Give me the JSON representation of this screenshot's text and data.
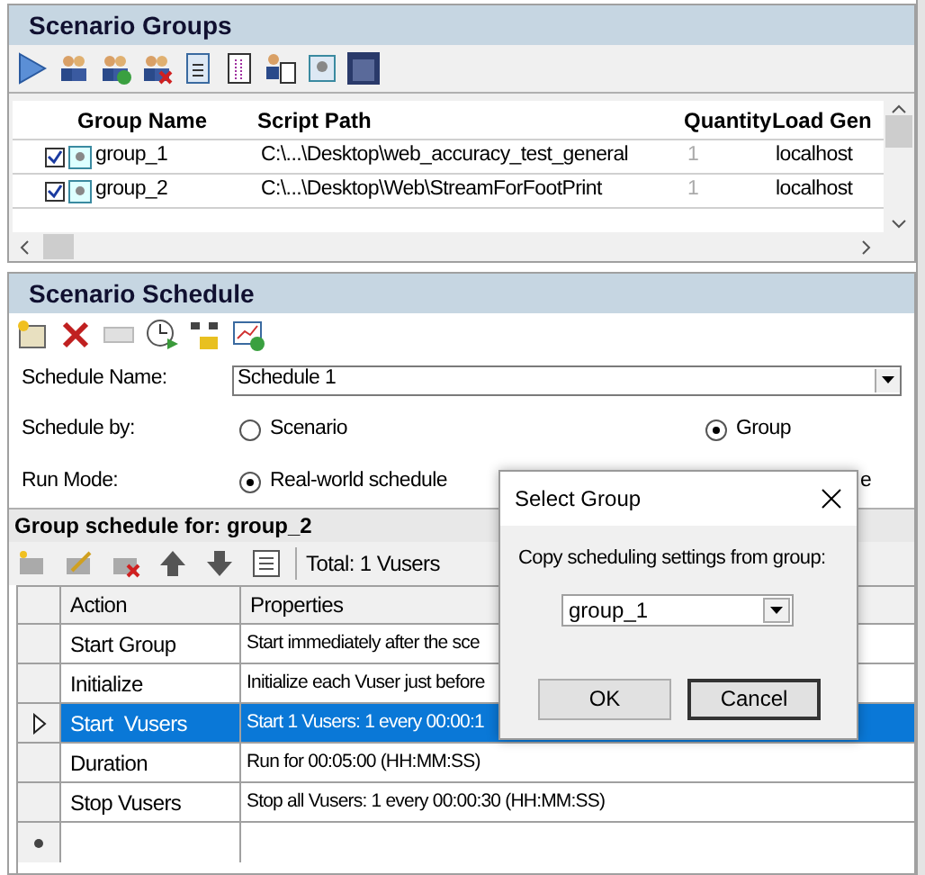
{
  "scenario_groups": {
    "title": "Scenario Groups",
    "columns": [
      "Group Name",
      "Script Path",
      "Quantity",
      "Load Gen"
    ],
    "rows": [
      {
        "checked": true,
        "name": "group_1",
        "script_path": "C:\\...\\Desktop\\web_accuracy_test_general",
        "quantity": "1",
        "load_generator": "localhost"
      },
      {
        "checked": true,
        "name": "group_2",
        "script_path": "C:\\...\\Desktop\\Web\\StreamForFootPrint",
        "quantity": "1",
        "load_generator": "localhost"
      }
    ]
  },
  "scenario_schedule": {
    "title": "Scenario Schedule",
    "schedule_name_label": "Schedule Name:",
    "schedule_name": "Schedule 1",
    "schedule_by_label": "Schedule by:",
    "schedule_by_options": [
      {
        "label": "Scenario",
        "selected": false
      },
      {
        "label": "Group",
        "selected": true
      }
    ],
    "run_mode_label": "Run Mode:",
    "run_mode_options": [
      {
        "label": "Real-world schedule",
        "selected": true
      }
    ],
    "run_mode_fragment": "e"
  },
  "group_schedule": {
    "title": "Group schedule for: group_2",
    "total": "Total: 1 Vusers",
    "columns": [
      "Action",
      "Properties"
    ],
    "rows": [
      {
        "action": "Start Group",
        "properties": "Start immediately after the sce",
        "selected": false
      },
      {
        "action": "Initialize",
        "properties": "Initialize each Vuser just before",
        "selected": false
      },
      {
        "action": "Start  Vusers",
        "properties": "Start 1 Vusers: 1 every 00:00:1",
        "selected": true
      },
      {
        "action": "Duration",
        "properties": "Run for 00:05:00 (HH:MM:SS)",
        "selected": false
      },
      {
        "action": "Stop Vusers",
        "properties": "Stop all Vusers: 1 every 00:00:30 (HH:MM:SS)",
        "selected": false
      }
    ]
  },
  "dialog": {
    "title": "Select Group",
    "prompt": "Copy scheduling settings from group:",
    "value": "group_1",
    "buttons": [
      "OK",
      "Cancel"
    ]
  }
}
